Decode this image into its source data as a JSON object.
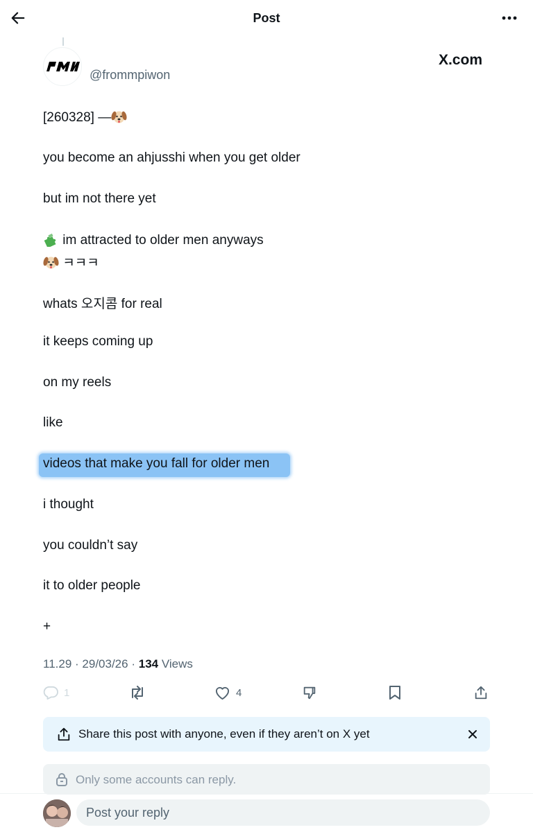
{
  "header": {
    "title": "Post",
    "back_icon": "arrow-left-icon",
    "more_icon": "more-horizontal-icon"
  },
  "author": {
    "handle": "@frommpiwon",
    "avatar_logo": "PMW",
    "source": "X.com"
  },
  "post": {
    "lines": [
      "[260328] —",
      "you become an ahjusshi when you get older",
      "but im not there yet",
      " im attracted to older men anyways",
      " ㅋㅋㅋ",
      "whats 오지콤 for real",
      "it keeps coming up",
      "on my reels",
      "like",
      "videos that make you fall for older men",
      "i thought",
      "you couldn’t say",
      "it to older people",
      "+"
    ],
    "emojis": [
      "dog-face-icon",
      "puzzle-piece-icon"
    ]
  },
  "meta": {
    "time": "11.29",
    "separator": "·",
    "date": "29/03/26",
    "views_count": "134",
    "views_label": "Views"
  },
  "actions": {
    "reply_count": "1",
    "like_count": "4"
  },
  "share_banner": {
    "text": "Share this post with anyone, even if they aren’t on X yet"
  },
  "reply_restriction": {
    "text": "Only some accounts can reply."
  },
  "reply_box": {
    "placeholder": "Post your reply"
  },
  "colors": {
    "text": "#0f1419",
    "secondary": "#536471",
    "highlight": "#8bc3f5",
    "banner_bg": "#e8f5fd",
    "restrict_bg": "#eff3f4"
  }
}
